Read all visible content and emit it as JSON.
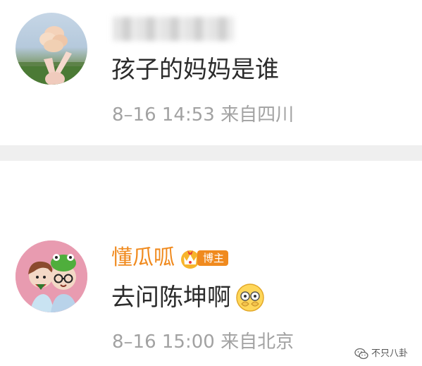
{
  "comments": [
    {
      "username": "",
      "username_blurred": true,
      "text": "孩子的妈妈是谁",
      "meta": "8–16 14:53  来自四川"
    },
    {
      "username": "懂瓜呱",
      "badge": {
        "label": "博主",
        "icon": "crown-badge-icon"
      },
      "text": "去问陈坤啊",
      "emoji": "facepalm-emoji-icon",
      "meta": "8–16 15:00  来自北京"
    }
  ],
  "watermark": {
    "text": "不只八卦",
    "icon": "wechat-icon"
  },
  "colors": {
    "username_accent": "#f08a1e",
    "body_text": "#2b2b2b",
    "meta_text": "#a2a2a2",
    "divider": "#efefef"
  }
}
